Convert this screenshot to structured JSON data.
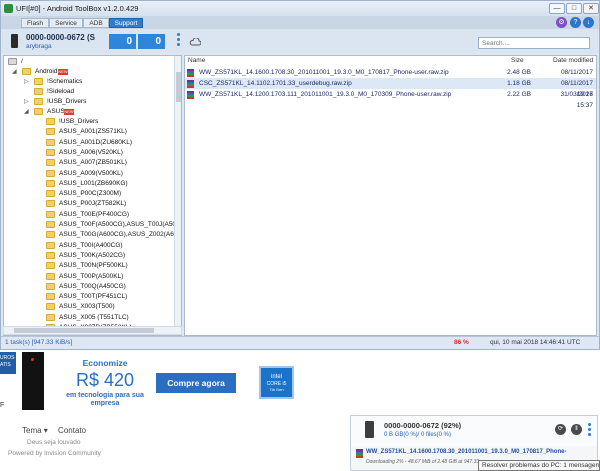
{
  "window": {
    "title": "UFI[#0] - Android ToolBox v1.2.0.429",
    "minimize_glyph": "—",
    "maximize_glyph": "□",
    "close_glyph": "✕"
  },
  "tabs": [
    "Flash",
    "Service",
    "ADB",
    "Support"
  ],
  "header_icons": {
    "a": "⚙",
    "b": "?",
    "c": "↓"
  },
  "device": {
    "id": "0000-0000-0672 (S",
    "user": "arybraga",
    "count1": "0",
    "count2": "0"
  },
  "search": {
    "placeholder": "Search...."
  },
  "tree": {
    "root_label": "/",
    "new_badge": "NEW",
    "items": [
      "Android",
      "!Schematics",
      "!Sideload",
      "!USB_Drivers",
      "ASUS",
      "!USB_Drivers",
      "ASUS_A001(ZS571KL)",
      "ASUS_A001D(ZU680KL)",
      "ASUS_A006(V520KL)",
      "ASUS_A007(ZB501KL)",
      "ASUS_A009(V500KL)",
      "ASUS_L001(ZB690KG)",
      "ASUS_P00C(Z300M)",
      "ASUS_P00J(ZT582KL)",
      "ASUS_T00E(PF400CG)",
      "ASUS_T00F(A500CG),ASUS_T00J(A501CG)",
      "ASUS_T00G(A600CG),ASUS_Z002(A601CG)",
      "ASUS_T00I(A400CG)",
      "ASUS_T00K(A502CG)",
      "ASUS_T00N(PF500KL)",
      "ASUS_T00P(A500KL)",
      "ASUS_T00Q(A450CG)",
      "ASUS_T00T(PF451CL)",
      "ASUS_X003(T500)",
      "ASUS_X005 (T551TLC)",
      "ASUS_X007D(ZB552KL)"
    ]
  },
  "files": {
    "headers": {
      "name": "Name",
      "size": "Size",
      "date": "Date modified"
    },
    "rows": [
      {
        "name": "WW_ZS571KL_14.1600.1708.30_201011001_19.3.0_M0_170817_Phone-user.raw.zip",
        "size": "2.48 GB",
        "date": "08/11/2017 22:12"
      },
      {
        "name": "CSC_ZS571KL_14.1102.1701.33_userdebug.raw.zip",
        "size": "1.18 GB",
        "date": "08/11/2017 19:26"
      },
      {
        "name": "WW_ZS571KL_14.1200.1703.111_201011001_19.3.0_M0_170309_Phone-user.raw.zip",
        "size": "2.22 GB",
        "date": "31/03/2017 15:37"
      }
    ]
  },
  "status": {
    "tasks": "1 task(s) [947.33 KiB/s]",
    "percent": "86 %",
    "datetime": "qui, 10 mai 2018 14:46:41 UTC"
  },
  "ad": {
    "side_text": "UROS ATIS",
    "headline": "Economize",
    "price": "R$ 420",
    "sub": "em tecnologia para sua empresa",
    "cta": "Compre agora",
    "intel_l1": "intel",
    "intel_l2": "CORE i5",
    "intel_l3": "7th Gen",
    "edge_char": "F"
  },
  "footer": {
    "nav": [
      "Tema ▾",
      "Contato"
    ],
    "line1": "Deus seja louvado",
    "line2": "Powered by Invision Community"
  },
  "notification": {
    "title": "0000-0000-0672 (92%)",
    "sub": "0 B GB(0 %)/ 0 files(0 %)",
    "file": "WW_ZS571KL_14.1600.1708.30_201011001_19.3.0_M0_170817_Phone-",
    "progress": "Downloading 2% - 48.67 MiB of 2.48 GiB at 947.33",
    "reload_glyph": "⟳",
    "pause_glyph": "‖"
  },
  "tooltip": "Resolver problemas do PC: 1 mensagem"
}
